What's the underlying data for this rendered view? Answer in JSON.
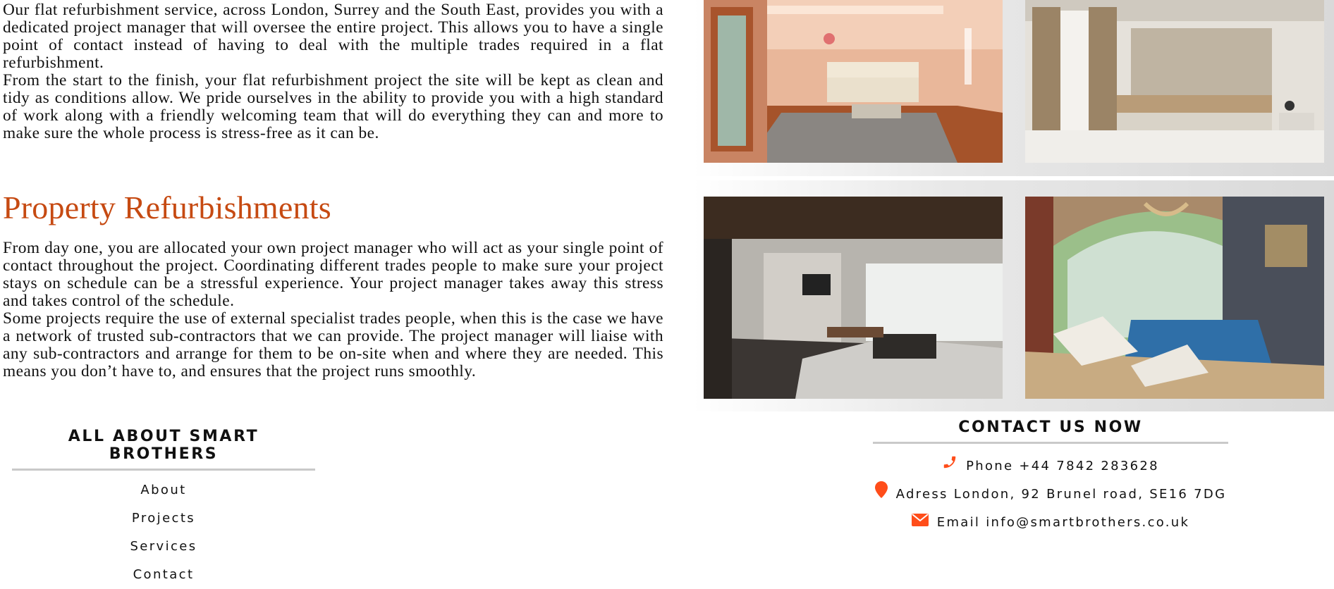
{
  "intro": {
    "paragraph_1": "Our flat refurbishment service, across London, Surrey and the South East, provides you with a dedicated project manager that will oversee the entire project. This allows you to have a single point of contact instead of having to deal with the multiple trades required in a flat refurbishment.",
    "paragraph_2": "From the start to the finish, your flat refurbishment project the site will be kept as clean and tidy as conditions allow. We pride ourselves in the ability to provide you with a high standard of work along with a friendly welcoming team that will do everything they can and more to make sure the whole process is stress-free as it can be."
  },
  "property": {
    "title": "Property Refurbishments",
    "paragraph_1": "From day one, you are allocated your own project manager who will act as your single point of contact throughout the project. Coordinating different trades people to make sure your project stays on schedule can be a stressful experience. Your project manager takes away this stress and takes control of the schedule.",
    "paragraph_2": "Some projects require the use of external specialist trades people, when this is the case we have a network of trusted sub-contractors that we can provide. The project manager will liaise with any sub-contractors and arrange for them to be on-site when and where they are needed. This means you don’t have to, and ensures that the project runs smoothly."
  },
  "gallery": {
    "images": [
      {
        "icon": "living-room-photo"
      },
      {
        "icon": "bedroom-photo"
      },
      {
        "icon": "open-plan-lounge-photo"
      },
      {
        "icon": "indoor-pool-photo"
      }
    ]
  },
  "footer": {
    "about": {
      "heading": "ALL ABOUT SMART BROTHERS",
      "links": [
        "About",
        "Projects",
        "Services",
        "Contact"
      ]
    },
    "contact": {
      "heading": "CONTACT US NOW",
      "phone": "Phone +44 7842 283628",
      "address": "Adress London, 92 Brunel road, SE16 7DG",
      "email": "Email info@smartbrothers.co.uk"
    }
  },
  "colors": {
    "accent": "#c64a12",
    "icon": "#ff4d1a",
    "divider": "#c9c9c9"
  }
}
